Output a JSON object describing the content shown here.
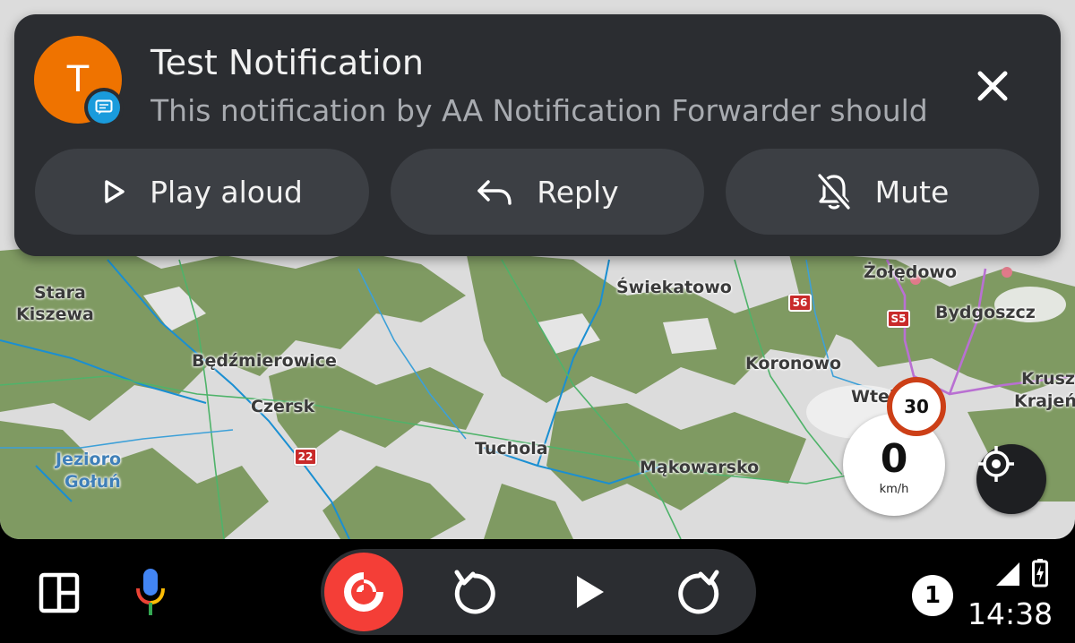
{
  "notification": {
    "avatar_letter": "T",
    "title": "Test Notification",
    "body": "This notification by AA Notification Forwarder should …",
    "actions": {
      "play_aloud": "Play aloud",
      "reply": "Reply",
      "mute": "Mute"
    },
    "avatar_color": "#ef7300",
    "badge_color": "#1a9bdc"
  },
  "map": {
    "towns": {
      "stara": "Stara",
      "kiszewa": "Kiszewa",
      "bedzmierowice": "Będźmierowice",
      "czersk": "Czersk",
      "jezioro": "Jezioro",
      "golun": "Gołuń",
      "tuchola": "Tuchola",
      "makowarsko": "Mąkowarsko",
      "swiekatowo": "Świekatowo",
      "koronowo": "Koronowo",
      "zoledowo": "Żołędowo",
      "bydgoszcz": "Bydgoszcz",
      "wtelno": "Wtel",
      "kruszyn": "Krusz",
      "krajenski": "Krajeń"
    },
    "roads": {
      "r22": "22",
      "r56": "56",
      "s5": "S5"
    }
  },
  "speed": {
    "limit": "30",
    "value": "0",
    "unit": "km/h"
  },
  "status_bar": {
    "notification_count": "1",
    "time": "14:38"
  },
  "icons": {
    "launcher": "layout-grid-icon",
    "mic": "microphone-icon",
    "media_app": "pocket-casts-icon",
    "rewind": "replay-icon",
    "play": "play-icon",
    "forward": "forward-icon",
    "recenter": "crosshair-icon"
  }
}
